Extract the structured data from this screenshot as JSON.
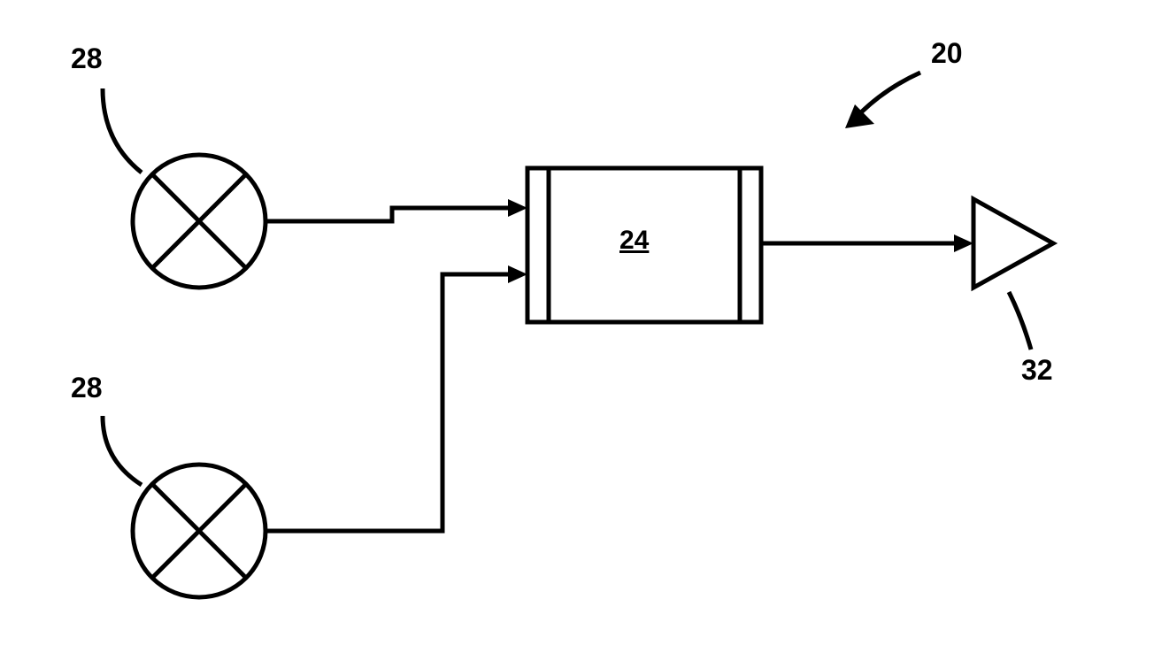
{
  "diagram": {
    "system_ref": "20",
    "inputs_ref": "28",
    "block_ref": "24",
    "output_ref": "32"
  }
}
